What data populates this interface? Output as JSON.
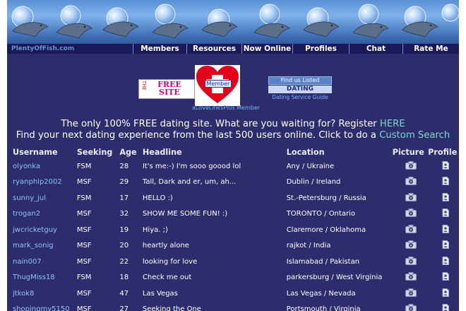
{
  "site": {
    "logo_text": "PlentyOfFish.com"
  },
  "nav": [
    {
      "label": "Members"
    },
    {
      "label": "Resources"
    },
    {
      "label": "Now Online"
    },
    {
      "label": "Profiles"
    },
    {
      "label": "Chat"
    },
    {
      "label": "Rate Me"
    }
  ],
  "ads": {
    "free_site_small": "THE",
    "free_site_big": "FREE SITE",
    "member_label": "Member",
    "member_caption": "aLoveLinksPlus Member",
    "dating_top": "Find us Listed",
    "dating_mid": "DATING",
    "dating_caption": "Dating Service Guide"
  },
  "intro": {
    "line1": "The only 100% FREE dating site. What are you waiting for? Register ",
    "line1_link": "HERE",
    "line2": "Find your next dating experience from the last 500 users online. Click to do a ",
    "line2_link": "Custom Search"
  },
  "table": {
    "headers": {
      "username": "Username",
      "seeking": "Seeking",
      "age": "Age",
      "headline": "Headline",
      "location": "Location",
      "picture": "Picture",
      "profile": "Profile"
    },
    "rows": [
      {
        "username": "olyonka",
        "seeking": "FSM",
        "age": "28",
        "headline": "It's me:-) I'm sooo goood lol",
        "location": "Any / Ukraine"
      },
      {
        "username": "ryanphlp2002",
        "seeking": "MSF",
        "age": "29",
        "headline": "Tall, Dark and er, um, ah...",
        "location": "Dublin / Ireland"
      },
      {
        "username": "sunny_jul",
        "seeking": "FSM",
        "age": "17",
        "headline": "HELLO :)",
        "location": "St.-Petersburg / Russia"
      },
      {
        "username": "trogan2",
        "seeking": "MSF",
        "age": "32",
        "headline": "SHOW ME SOME FUN! :)",
        "location": "TORONTO / Ontario"
      },
      {
        "username": "jwcricketguy",
        "seeking": "MSF",
        "age": "19",
        "headline": "Hiya. ;)",
        "location": "Claremore / Oklahoma"
      },
      {
        "username": "mark_sonig",
        "seeking": "MSF",
        "age": "20",
        "headline": "heartly alone",
        "location": "rajkot / India"
      },
      {
        "username": "nain007",
        "seeking": "MSF",
        "age": "22",
        "headline": "looking for love",
        "location": "Islamabad / Pakistan"
      },
      {
        "username": "ThugMiss18",
        "seeking": "FSM",
        "age": "18",
        "headline": "Check me out",
        "location": "parkersburg / West Virginia"
      },
      {
        "username": "jtkok8",
        "seeking": "MSF",
        "age": "47",
        "headline": "Las Vegas",
        "location": "Las Vegas / Nevada"
      },
      {
        "username": "shopingmy5150",
        "seeking": "MSF",
        "age": "27",
        "headline": "Seeking the One",
        "location": "Portsmouth / Virginia"
      }
    ]
  },
  "colors": {
    "page_bg": "#2d2d6e",
    "nav_bg": "#1a1a5a",
    "username_link": "#8fc0ff",
    "intro_link": "#7fd8c6"
  }
}
